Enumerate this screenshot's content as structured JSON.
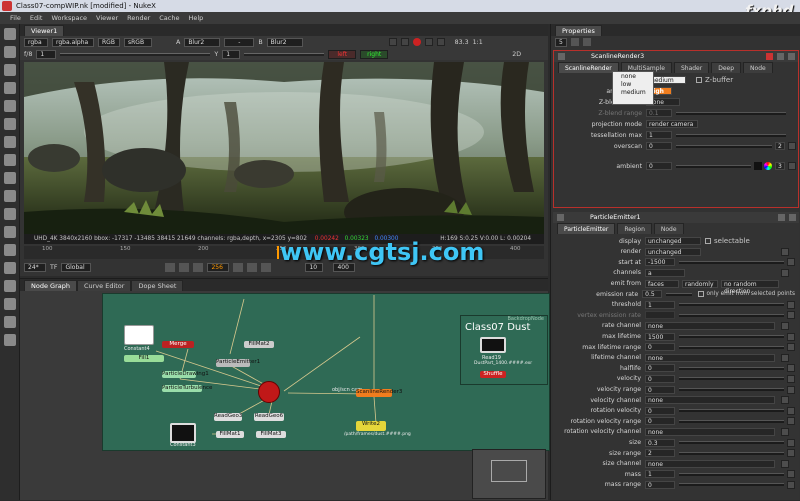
{
  "window": {
    "title": "Class07-compWIP.nk [modified] - NukeX"
  },
  "watermarks": {
    "fxphd": "fxphd",
    "cgtsj": "www.cgtsj.com"
  },
  "menu": [
    "File",
    "Edit",
    "Workspace",
    "Viewer",
    "Render",
    "Cache",
    "Help"
  ],
  "viewer": {
    "tab": "Viewer1",
    "channels": "rgba",
    "alpha": "rgba.alpha",
    "display": "RGB",
    "lut": "sRGB",
    "input_a_label": "A",
    "input_a": "Blur2",
    "dash": "-",
    "input_b_label": "B",
    "input_b": "Blur2",
    "fstop": "f/8",
    "frame_one": "1",
    "y_label": "Y",
    "y_value": "1",
    "left_eye": "left",
    "right_eye": "right",
    "zoom": "83.3",
    "ratio": "1:1",
    "view": "2D",
    "status_format": "UHD_4K 3840x2160  bbox: -17317 -13485 38415 21649 channels: rgba,depth, x=2305 y=802",
    "status_r": "0.00242",
    "status_g": "0.00323",
    "status_b": "0.00300",
    "status_hsv": "H:169 S:0.25 V:0.00 L: 0.00204",
    "fps": "24*",
    "tf": "TF",
    "scope": "Global",
    "frame": "256",
    "increment": "10",
    "end_frame": "400"
  },
  "timeline_ticks": [
    "100",
    "150",
    "200",
    "250",
    "300",
    "350",
    "400"
  ],
  "node_graph": {
    "tabs": [
      "Node Graph",
      "Curve Editor",
      "Dope Sheet"
    ],
    "backdrop_title": "Class07 Dust",
    "backdrop_label": "BackdropNode",
    "nodes": {
      "constant4": "Constant4",
      "fill1": "Fill1",
      "merge": "Merge",
      "particle_drawing": "ParticleDrawing1",
      "particle_turbulence": "ParticleTurbulence",
      "particle_emitter": "ParticleEmitter1",
      "fillmat2": "FillMat2",
      "scanline_top": "ScanlineRender",
      "read_geo3": "ReadGeo3",
      "read_geo6": "ReadGeo6",
      "fillmat1": "FillMat1",
      "fillmat3": "FillMat3",
      "constant3": "Constant3",
      "scene": "Scene",
      "scanline_render3": "ScanlineRender3",
      "write2": "Write2",
      "write2_sub": "/path/frames/dust.####.png",
      "read19": "Read19",
      "read19_sub": "DustPart_1400.####.exr",
      "shuffle": "Shuffle",
      "obj_scn_cam": "obj/scn   cam"
    }
  },
  "properties": {
    "title": "Properties",
    "count": "5",
    "panel1": {
      "name": "ScanlineRender3",
      "tabs": [
        "ScanlineRender",
        "MultiSample",
        "Shader",
        "Deep",
        "Node"
      ],
      "filter_label": "filter",
      "filter_options": [
        "none",
        "low",
        "medium"
      ],
      "filter_check": "Z-buffer",
      "antialiasing_label": "antialiasing",
      "antialiasing_value": "high",
      "zblend_mode_label": "Z-blend mode",
      "zblend_mode_value": "none",
      "zblend_range_label": "Z-blend range",
      "zblend_range_value": "0.1",
      "projection_mode_label": "projection mode",
      "projection_mode_value": "render camera",
      "tessellation_label": "tessellation max",
      "tessellation_value": "1",
      "overscan_label": "overscan",
      "overscan_value": "0",
      "overscan_right": "2",
      "ambient_label": "ambient",
      "ambient_value": "0",
      "ambient_right": "3"
    },
    "panel2": {
      "name": "ParticleEmitter1",
      "tabs": [
        "ParticleEmitter",
        "Region",
        "Node"
      ],
      "rows": [
        {
          "label": "display",
          "value": "unchanged",
          "extra": "selectable",
          "type": "select"
        },
        {
          "label": "render",
          "value": "unchanged",
          "type": "select"
        },
        {
          "label": "start at",
          "value": "-1500",
          "type": "num"
        },
        {
          "label": "channels",
          "value": "a",
          "type": "select"
        },
        {
          "label": "emit from",
          "value": "faces",
          "extra": "randomly",
          "extra2": "no random direction",
          "type": "emit"
        },
        {
          "label": "emission rate",
          "value": "0.5",
          "extra": "only emit from selected points",
          "type": "emission"
        },
        {
          "label": "threshold",
          "value": "1",
          "type": "num"
        },
        {
          "label": "vertex emission rate",
          "value": "",
          "type": "dim"
        },
        {
          "label": "rate channel",
          "value": "none",
          "type": "select"
        },
        {
          "label": "max lifetime",
          "value": "1500",
          "type": "num"
        },
        {
          "label": "max lifetime range",
          "value": "0",
          "type": "num"
        },
        {
          "label": "lifetime channel",
          "value": "none",
          "type": "select"
        },
        {
          "label": "halflife",
          "value": "0",
          "type": "num"
        },
        {
          "label": "velocity",
          "value": "0",
          "type": "num"
        },
        {
          "label": "velocity range",
          "value": "0",
          "type": "num"
        },
        {
          "label": "velocity channel",
          "value": "none",
          "type": "select"
        },
        {
          "label": "rotation velocity",
          "value": "0",
          "type": "num"
        },
        {
          "label": "rotation velocity range",
          "value": "0",
          "type": "num"
        },
        {
          "label": "rotation velocity channel",
          "value": "none",
          "type": "select"
        },
        {
          "label": "size",
          "value": "0.3",
          "type": "num"
        },
        {
          "label": "size range",
          "value": "2",
          "type": "num"
        },
        {
          "label": "size channel",
          "value": "none",
          "type": "select"
        },
        {
          "label": "mass",
          "value": "1",
          "type": "num"
        },
        {
          "label": "mass range",
          "value": "0",
          "type": "num"
        }
      ]
    }
  },
  "colors": {
    "accent": "#e5c43a",
    "highlight": "#f07d1e",
    "graph_bg": "#2f6a55",
    "panel_red": "#b8302b"
  }
}
